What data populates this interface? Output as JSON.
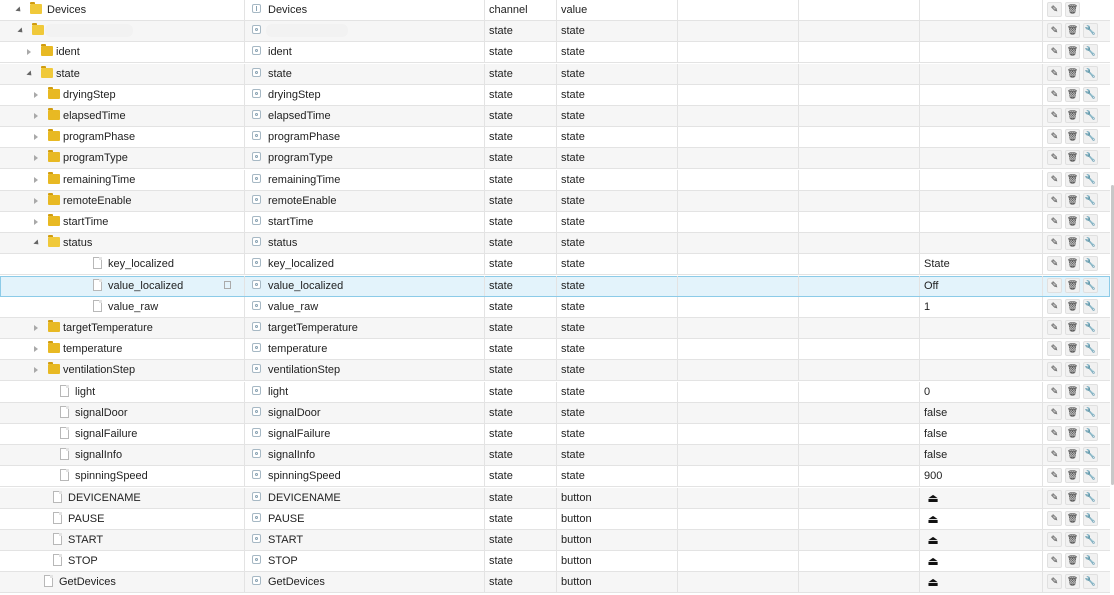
{
  "header": {
    "name": "Devices",
    "object": "Devices",
    "type": "channel",
    "role": "value"
  },
  "redacted_name": "",
  "icons": {
    "edit": "pencil-icon",
    "delete": "trash-icon",
    "config": "wrench-icon",
    "button_value": "eject-icon"
  },
  "action_glyphs": {
    "edit": "✎",
    "delete": "🗑",
    "config": "🔧",
    "button_value": "⏏"
  },
  "rows": [
    {
      "id": "device",
      "name": "",
      "object": "",
      "type": "state",
      "role": "state",
      "value": "",
      "depth": 1,
      "kind": "folder",
      "open": true,
      "toggle": "expanded",
      "redacted": true
    },
    {
      "id": "ident",
      "name": "ident",
      "object": "ident",
      "type": "state",
      "role": "state",
      "value": "",
      "depth": 2,
      "kind": "folder",
      "toggle": "collapsed"
    },
    {
      "id": "state",
      "name": "state",
      "object": "state",
      "type": "state",
      "role": "state",
      "value": "",
      "depth": 2,
      "kind": "folder",
      "open": true,
      "toggle": "expanded"
    },
    {
      "id": "dryingStep",
      "name": "dryingStep",
      "object": "dryingStep",
      "type": "state",
      "role": "state",
      "value": "",
      "depth": 3,
      "kind": "folder",
      "toggle": "collapsed"
    },
    {
      "id": "elapsedTime",
      "name": "elapsedTime",
      "object": "elapsedTime",
      "type": "state",
      "role": "state",
      "value": "",
      "depth": 3,
      "kind": "folder",
      "toggle": "collapsed"
    },
    {
      "id": "programPhase",
      "name": "programPhase",
      "object": "programPhase",
      "type": "state",
      "role": "state",
      "value": "",
      "depth": 3,
      "kind": "folder",
      "toggle": "collapsed"
    },
    {
      "id": "programType",
      "name": "programType",
      "object": "programType",
      "type": "state",
      "role": "state",
      "value": "",
      "depth": 3,
      "kind": "folder",
      "toggle": "collapsed"
    },
    {
      "id": "remainingTime",
      "name": "remainingTime",
      "object": "remainingTime",
      "type": "state",
      "role": "state",
      "value": "",
      "depth": 3,
      "kind": "folder",
      "toggle": "collapsed"
    },
    {
      "id": "remoteEnable",
      "name": "remoteEnable",
      "object": "remoteEnable",
      "type": "state",
      "role": "state",
      "value": "",
      "depth": 3,
      "kind": "folder",
      "toggle": "collapsed"
    },
    {
      "id": "startTime",
      "name": "startTime",
      "object": "startTime",
      "type": "state",
      "role": "state",
      "value": "",
      "depth": 3,
      "kind": "folder",
      "toggle": "collapsed"
    },
    {
      "id": "status",
      "name": "status",
      "object": "status",
      "type": "state",
      "role": "state",
      "value": "",
      "depth": 3,
      "kind": "folder",
      "open": true,
      "toggle": "expanded"
    },
    {
      "id": "key_localized",
      "name": "key_localized",
      "object": "key_localized",
      "type": "state",
      "role": "state",
      "value": "State",
      "depth": 4,
      "kind": "file"
    },
    {
      "id": "value_localized",
      "name": "value_localized",
      "object": "value_localized",
      "type": "state",
      "role": "state",
      "value": "Off",
      "depth": 4,
      "kind": "file",
      "selected": true
    },
    {
      "id": "value_raw",
      "name": "value_raw",
      "object": "value_raw",
      "type": "state",
      "role": "state",
      "value": "1",
      "depth": 4,
      "kind": "file"
    },
    {
      "id": "targetTemperature",
      "name": "targetTemperature",
      "object": "targetTemperature",
      "type": "state",
      "role": "state",
      "value": "",
      "depth": 3,
      "kind": "folder",
      "toggle": "collapsed"
    },
    {
      "id": "temperature",
      "name": "temperature",
      "object": "temperature",
      "type": "state",
      "role": "state",
      "value": "",
      "depth": 3,
      "kind": "folder",
      "toggle": "collapsed"
    },
    {
      "id": "ventilationStep",
      "name": "ventilationStep",
      "object": "ventilationStep",
      "type": "state",
      "role": "state",
      "value": "",
      "depth": 3,
      "kind": "folder",
      "toggle": "collapsed"
    },
    {
      "id": "light",
      "name": "light",
      "object": "light",
      "type": "state",
      "role": "state",
      "value": "0",
      "depth": 3,
      "kind": "file"
    },
    {
      "id": "signalDoor",
      "name": "signalDoor",
      "object": "signalDoor",
      "type": "state",
      "role": "state",
      "value": "false",
      "depth": 3,
      "kind": "file"
    },
    {
      "id": "signalFailure",
      "name": "signalFailure",
      "object": "signalFailure",
      "type": "state",
      "role": "state",
      "value": "false",
      "depth": 3,
      "kind": "file"
    },
    {
      "id": "signalInfo",
      "name": "signalInfo",
      "object": "signalInfo",
      "type": "state",
      "role": "state",
      "value": "false",
      "depth": 3,
      "kind": "file"
    },
    {
      "id": "spinningSpeed",
      "name": "spinningSpeed",
      "object": "spinningSpeed",
      "type": "state",
      "role": "state",
      "value": "900",
      "depth": 3,
      "kind": "file"
    },
    {
      "id": "DEVICENAME",
      "name": "DEVICENAME",
      "object": "DEVICENAME",
      "type": "state",
      "role": "button",
      "value": "",
      "depth": 2,
      "kind": "file",
      "button": true
    },
    {
      "id": "PAUSE",
      "name": "PAUSE",
      "object": "PAUSE",
      "type": "state",
      "role": "button",
      "value": "",
      "depth": 2,
      "kind": "file",
      "button": true
    },
    {
      "id": "START",
      "name": "START",
      "object": "START",
      "type": "state",
      "role": "button",
      "value": "",
      "depth": 2,
      "kind": "file",
      "button": true
    },
    {
      "id": "STOP",
      "name": "STOP",
      "object": "STOP",
      "type": "state",
      "role": "button",
      "value": "",
      "depth": 2,
      "kind": "file",
      "button": true
    },
    {
      "id": "GetDevices",
      "name": "GetDevices",
      "object": "GetDevices",
      "type": "state",
      "role": "button",
      "value": "",
      "depth": 1,
      "kind": "file",
      "button": true
    }
  ]
}
